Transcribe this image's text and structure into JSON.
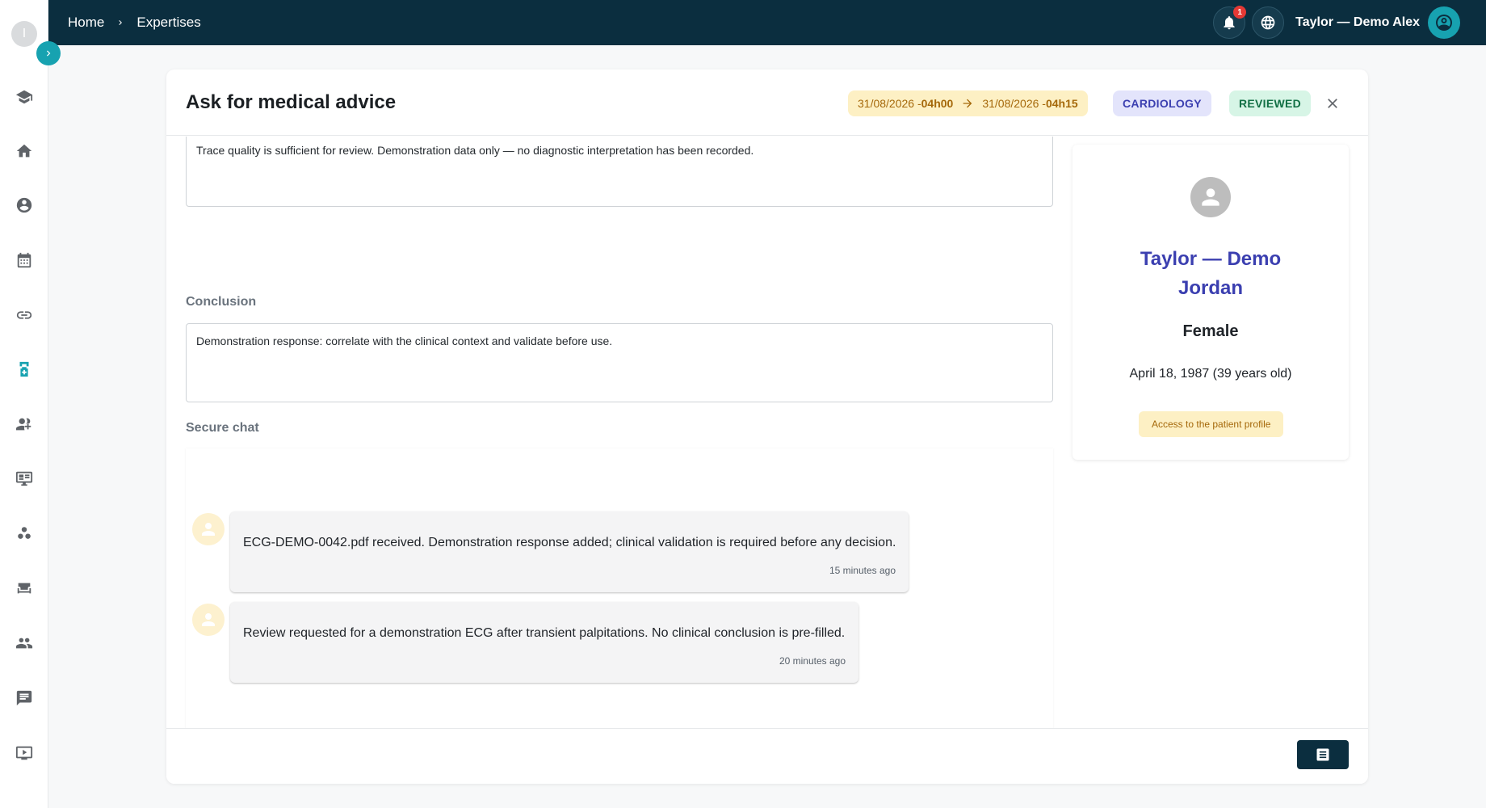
{
  "sidebar": {
    "logo_letter": "I",
    "items": [
      {
        "icon": "graduation-cap-icon"
      },
      {
        "icon": "home-icon"
      },
      {
        "icon": "doctor-icon"
      },
      {
        "icon": "calendar-icon"
      },
      {
        "icon": "link-icon"
      },
      {
        "icon": "medical-team-icon",
        "active": true
      },
      {
        "icon": "group-add-icon"
      },
      {
        "icon": "monitor-icon"
      },
      {
        "icon": "bubbles-icon"
      },
      {
        "icon": "couch-icon"
      },
      {
        "icon": "people-icon"
      },
      {
        "icon": "chat-icon"
      },
      {
        "icon": "video-icon"
      }
    ]
  },
  "topbar": {
    "breadcrumb": [
      "Home",
      "Expertises"
    ],
    "notifications_count": "1",
    "user_name": "Taylor — Demo Alex"
  },
  "modal": {
    "title": "Ask for medical advice",
    "date_start": "31/08/2026 - ",
    "time_start": "04h00",
    "date_end": "31/08/2026 - ",
    "time_end": "04h15",
    "specialty": "CARDIOLOGY",
    "status": "REVIEWED",
    "interpretation_text": "Trace quality is sufficient for review. Demonstration data only — no diagnostic interpretation has been recorded.",
    "conclusion_label": "Conclusion",
    "conclusion_text": "Demonstration response: correlate with the clinical context and validate before use.",
    "chat_label": "Secure chat",
    "messages": [
      {
        "text": "ECG-DEMO-0042.pdf received. Demonstration response added; clinical validation is required before any decision.",
        "time": "15 minutes ago"
      },
      {
        "text": "Review requested for a demonstration ECG after transient palpitations. No clinical conclusion is pre-filled.",
        "time": "20 minutes ago"
      }
    ]
  },
  "patient": {
    "name": "Taylor — Demo Jordan",
    "gender": "Female",
    "dob": "April 18, 1987 (39 years old)",
    "profile_button": "Access to the patient profile"
  },
  "colors": {
    "topbar": "#0b2e3f",
    "accent": "#17a2b0",
    "name": "#3b3fb0",
    "date_chip_bg": "#fdf0c4",
    "reviewed_bg": "#d7f5e6"
  }
}
